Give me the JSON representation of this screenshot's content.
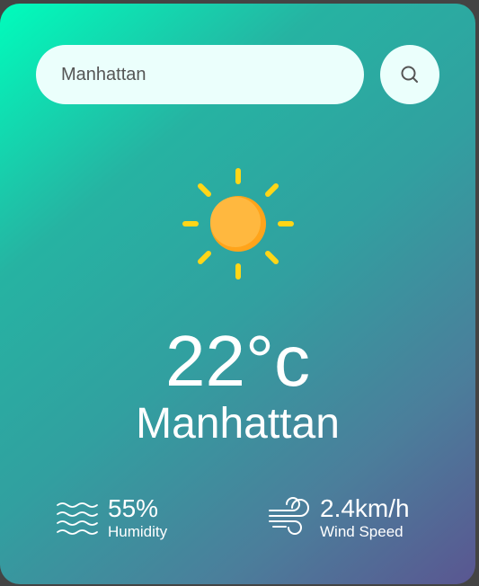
{
  "search": {
    "value": "Manhattan",
    "button_icon": "search-icon"
  },
  "weather": {
    "icon": "sun-icon",
    "temperature": "22°c",
    "city": "Manhattan"
  },
  "details": {
    "humidity": {
      "icon": "humidity-waves-icon",
      "value": "55%",
      "label": "Humidity"
    },
    "wind": {
      "icon": "wind-icon",
      "value": "2.4km/h",
      "label": "Wind Speed"
    }
  },
  "colors": {
    "gradient_start": "#00fdbc",
    "gradient_end": "#5a5691",
    "search_bg": "#ebfffc",
    "sun": "#ffb53f",
    "sun_rays": "#ffd617"
  }
}
